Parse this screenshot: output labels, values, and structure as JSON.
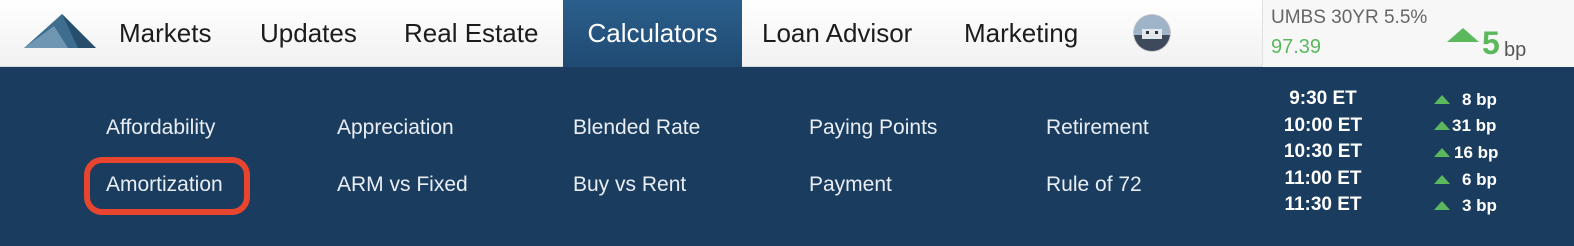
{
  "nav": {
    "items": [
      {
        "label": "Markets"
      },
      {
        "label": "Updates"
      },
      {
        "label": "Real Estate"
      },
      {
        "label": "Calculators"
      },
      {
        "label": "Loan Advisor"
      },
      {
        "label": "Marketing"
      }
    ],
    "active": "Calculators"
  },
  "ticker": {
    "name": "UMBS 30YR 5.5%",
    "price": "97.39",
    "change": "5",
    "unit": "bp",
    "direction": "up"
  },
  "calculators": {
    "row1": [
      "Affordability",
      "Appreciation",
      "Blended Rate",
      "Paying Points",
      "Retirement"
    ],
    "row2": [
      "Amortization",
      "ARM vs Fixed",
      "Buy vs Rent",
      "Payment",
      "Rule of 72"
    ],
    "highlighted": "Amortization"
  },
  "schedule": [
    {
      "time": "9:30 ET",
      "change": "8 bp"
    },
    {
      "time": "10:00 ET",
      "change": "31 bp"
    },
    {
      "time": "10:30 ET",
      "change": "16 bp"
    },
    {
      "time": "11:00 ET",
      "change": "6 bp"
    },
    {
      "time": "11:30 ET",
      "change": "3 bp"
    }
  ],
  "colors": {
    "menu_bg": "#1a3c5e",
    "active_tab": "#2b5f8c",
    "up": "#5cb85c",
    "highlight": "#e8452f"
  }
}
